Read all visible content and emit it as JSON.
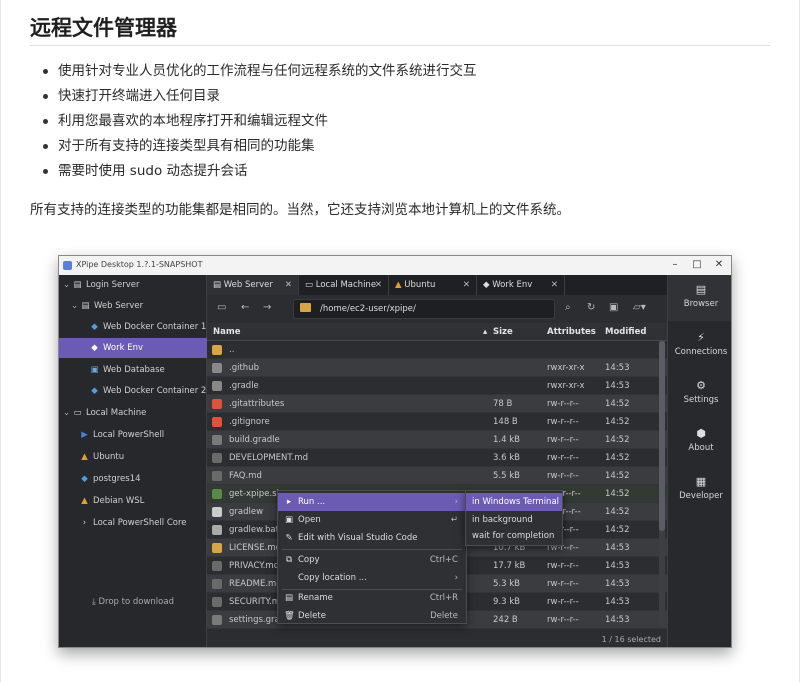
{
  "heading": "远程文件管理器",
  "features": [
    "使用针对专业人员优化的工作流程与任何远程系统的文件系统进行交互",
    "快速打开终端进入任何目录",
    "利用您最喜欢的本地程序打开和编辑远程文件",
    "对于所有支持的连接类型具有相同的功能集",
    "需要时使用 sudo 动态提升会话"
  ],
  "summary": "所有支持的连接类型的功能集都是相同的。当然，它还支持浏览本地计算机上的文件系统。",
  "app": {
    "window_title": "XPipe Desktop 1.?.1-SNAPSHOT",
    "sidebar": {
      "items": [
        {
          "label": "Login Server",
          "icon": "server-icon"
        },
        {
          "label": "Web Server",
          "icon": "server-icon"
        },
        {
          "label": "Web Docker Container 1",
          "icon": "docker-icon"
        },
        {
          "label": "Work Env",
          "icon": "docker-icon"
        },
        {
          "label": "Web Database",
          "icon": "database-icon"
        },
        {
          "label": "Web Docker Container 2",
          "icon": "docker-icon"
        },
        {
          "label": "Local Machine",
          "icon": "monitor-icon"
        },
        {
          "label": "Local PowerShell",
          "icon": "powershell-icon"
        },
        {
          "label": "Ubuntu",
          "icon": "ubuntu-icon"
        },
        {
          "label": "postgres14",
          "icon": "docker-icon"
        },
        {
          "label": "Debian WSL",
          "icon": "debian-icon"
        },
        {
          "label": "Local PowerShell Core",
          "icon": "powershell-icon"
        }
      ],
      "drop_label": "Drop to download"
    },
    "tabs": [
      {
        "label": "Web Server"
      },
      {
        "label": "Local Machine"
      },
      {
        "label": "Ubuntu"
      },
      {
        "label": "Work Env"
      }
    ],
    "path": "/home/ec2-user/xpipe/",
    "columns": {
      "name": "Name",
      "size": "Size",
      "attributes": "Attributes",
      "modified": "Modified"
    },
    "files": [
      {
        "name": "..",
        "size": "",
        "attrs": "",
        "mod": "",
        "color": "#d7a544"
      },
      {
        "name": ".github",
        "size": "",
        "attrs": "rwxr-xr-x",
        "mod": "14:53",
        "color": "#888888"
      },
      {
        "name": ".gradle",
        "size": "",
        "attrs": "rwxr-xr-x",
        "mod": "14:53",
        "color": "#888888"
      },
      {
        "name": ".gitattributes",
        "size": "78 B",
        "attrs": "rw-r--r--",
        "mod": "14:52",
        "color": "#e0523a"
      },
      {
        "name": ".gitignore",
        "size": "148 B",
        "attrs": "rw-r--r--",
        "mod": "14:52",
        "color": "#e0523a"
      },
      {
        "name": "build.gradle",
        "size": "1.4 kB",
        "attrs": "rw-r--r--",
        "mod": "14:52",
        "color": "#7a7a7a"
      },
      {
        "name": "DEVELOPMENT.md",
        "size": "3.6 kB",
        "attrs": "rw-r--r--",
        "mod": "14:52",
        "color": "#6a6a6a"
      },
      {
        "name": "FAQ.md",
        "size": "5.5 kB",
        "attrs": "rw-r--r--",
        "mod": "14:52",
        "color": "#6a6a6a"
      },
      {
        "name": "get-xpipe.sh",
        "size": "",
        "attrs": "rwxr--r--",
        "mod": "14:52",
        "color": "#5a8a4a"
      },
      {
        "name": "gradlew",
        "size": "",
        "attrs": "rwxr--r--",
        "mod": "14:52",
        "color": "#cccccc"
      },
      {
        "name": "gradlew.bat",
        "size": "",
        "attrs": "rw-r--r--",
        "mod": "14:52",
        "color": "#aaaaaa"
      },
      {
        "name": "LICENSE.md",
        "size": "10.7 kB",
        "attrs": "rw-r--r--",
        "mod": "14:53",
        "color": "#d7a544"
      },
      {
        "name": "PRIVACY.md",
        "size": "17.7 kB",
        "attrs": "rw-r--r--",
        "mod": "14:53",
        "color": "#6a6a6a"
      },
      {
        "name": "README.md",
        "size": "5.3 kB",
        "attrs": "rw-r--r--",
        "mod": "14:53",
        "color": "#6a6a6a"
      },
      {
        "name": "SECURITY.md",
        "size": "9.3 kB",
        "attrs": "rw-r--r--",
        "mod": "14:53",
        "color": "#6a6a6a"
      },
      {
        "name": "settings.gradle",
        "size": "242 B",
        "attrs": "rw-r--r--",
        "mod": "14:53",
        "color": "#7a7a7a"
      }
    ],
    "status": "1 / 16 selected",
    "right_nav": [
      {
        "label": "Browser",
        "icon": "browser-icon"
      },
      {
        "label": "Connections",
        "icon": "connections-icon"
      },
      {
        "label": "Settings",
        "icon": "settings-icon"
      },
      {
        "label": "About",
        "icon": "about-icon"
      },
      {
        "label": "Developer",
        "icon": "developer-icon"
      }
    ],
    "context_menu": [
      {
        "label": "Run ...",
        "shortcut": "›",
        "icon": "play-icon"
      },
      {
        "label": "Open",
        "shortcut": "↵",
        "icon": "open-icon"
      },
      {
        "label": "Edit with Visual Studio Code",
        "shortcut": "",
        "icon": "edit-icon"
      },
      {
        "label": "Copy",
        "shortcut": "Ctrl+C",
        "icon": "copy-icon"
      },
      {
        "label": "Copy location ...",
        "shortcut": "›",
        "icon": ""
      },
      {
        "label": "Rename",
        "shortcut": "Ctrl+R",
        "icon": "rename-icon"
      },
      {
        "label": "Delete",
        "shortcut": "Delete",
        "icon": "delete-icon"
      }
    ],
    "submenu": [
      {
        "label": "in Windows Terminal"
      },
      {
        "label": "in background"
      },
      {
        "label": "wait for completion"
      }
    ],
    "accent": "#6c5bb5"
  }
}
